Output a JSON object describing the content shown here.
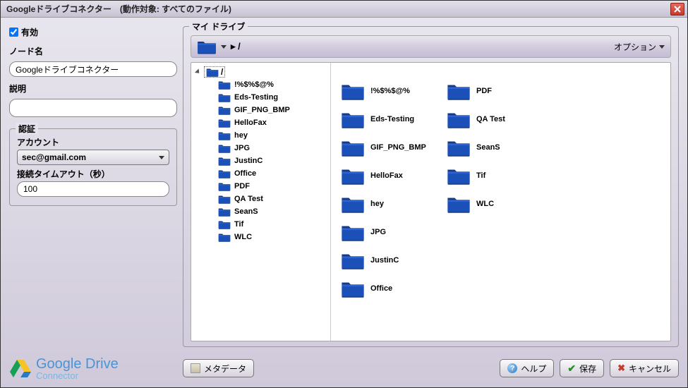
{
  "titlebar": {
    "text": "Googleドライブコネクター　(動作対象: すべてのファイル)"
  },
  "left": {
    "enabled_label": "有効",
    "nodename_label": "ノード名",
    "nodename_value": "Googleドライブコネクター",
    "description_label": "説明",
    "description_value": "",
    "auth_legend": "認証",
    "account_label": "アカウント",
    "account_value": "sec@gmail.com",
    "timeout_label": "接続タイムアウト（秒）",
    "timeout_value": "100"
  },
  "drive": {
    "legend": "マイ ドライブ",
    "options_label": "オプション",
    "path_sep": "▸ /",
    "root_label": "/",
    "tree_items": [
      "!%$%$@%",
      "Eds-Testing",
      "GIF_PNG_BMP",
      "HelloFax",
      "hey",
      "JPG",
      "JustinC",
      "Office",
      "PDF",
      "QA Test",
      "SeanS",
      "Tif",
      "WLC"
    ],
    "grid_items": [
      "!%$%$@%",
      "Eds-Testing",
      "GIF_PNG_BMP",
      "HelloFax",
      "hey",
      "JPG",
      "JustinC",
      "Office",
      "PDF",
      "QA Test",
      "SeanS",
      "Tif",
      "WLC"
    ]
  },
  "footer": {
    "logo_line1": "Google Drive",
    "logo_line2": "Connector",
    "metadata_label": "メタデータ",
    "help_label": "ヘルプ",
    "save_label": "保存",
    "cancel_label": "キャンセル"
  }
}
